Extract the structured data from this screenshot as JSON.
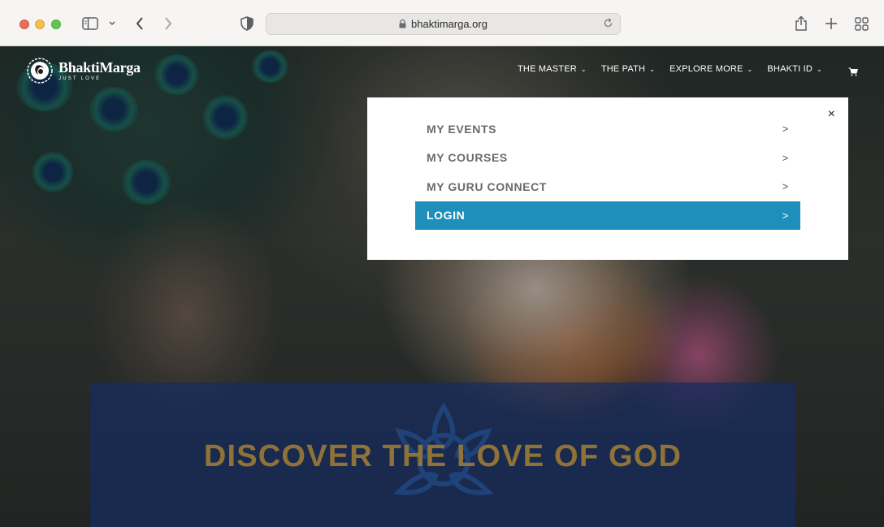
{
  "browser": {
    "url": "bhaktimarga.org"
  },
  "site": {
    "logo_name": "BhaktiMarga",
    "logo_tagline": "JUST LOVE",
    "nav": [
      {
        "label": "THE MASTER"
      },
      {
        "label": "THE PATH"
      },
      {
        "label": "EXPLORE MORE"
      },
      {
        "label": "BHAKTI ID"
      }
    ]
  },
  "dropdown": {
    "close_symbol": "×",
    "items": [
      {
        "label": "MY EVENTS",
        "arrow": ">"
      },
      {
        "label": "MY COURSES",
        "arrow": ">"
      },
      {
        "label": "MY GURU CONNECT",
        "arrow": ">"
      },
      {
        "label": "LOGIN",
        "arrow": ">",
        "active": true
      }
    ]
  },
  "hero": {
    "title": "DISCOVER THE LOVE OF GOD"
  },
  "colors": {
    "accent": "#1e8fbb",
    "banner": "#162c60",
    "title_gold": "#8f7237"
  }
}
